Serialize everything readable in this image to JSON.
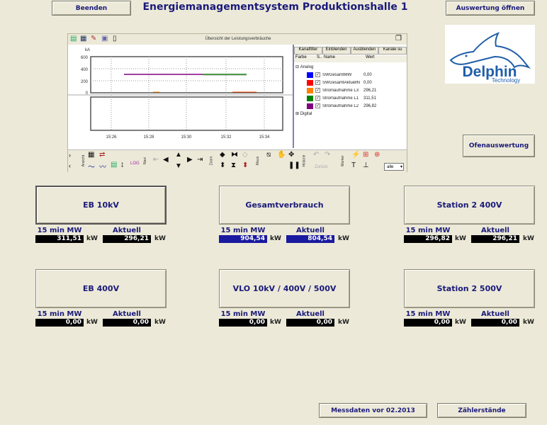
{
  "header": {
    "exit": "Beenden",
    "title": "Energiemanagementsystem Produktionshalle 1",
    "open_eval": "Auswertung öffnen"
  },
  "logo": {
    "brand": "Delphin",
    "sub": "Technology"
  },
  "chart": {
    "title": "Übersicht der Leistungsverbräuche",
    "unit": "kA",
    "yticks": [
      "600",
      "400",
      "200",
      "0"
    ],
    "xticks": [
      "15:26",
      "15:28",
      "15:30",
      "15:32",
      "15:34"
    ]
  },
  "legend": {
    "tabs": [
      "Kanalfilter",
      "Einblenden",
      "Ausblenden",
      "Kanäle su"
    ],
    "cols": [
      "Farbe",
      "S..",
      "Name",
      "Wert"
    ],
    "group_analog": "Analog",
    "group_digital": "Digital",
    "channels": [
      {
        "name": "SWGesamtMW",
        "value": "0,00",
        "color": "#0000ff"
      },
      {
        "name": "SWGesamtAktuellN",
        "value": "0,00",
        "color": "#ff0000"
      },
      {
        "name": "Stromaufnahme L3",
        "value": "296,21",
        "color": "#ff8000"
      },
      {
        "name": "Stromaufnahme L1",
        "value": "311,51",
        "color": "#008000"
      },
      {
        "name": "Stromaufnahme L2",
        "value": "296,82",
        "color": "#800080"
      }
    ]
  },
  "toolbar": {
    "groups": [
      "Ansicht",
      "Navi",
      "Zoom",
      "Maus",
      "Historie",
      "Marker"
    ],
    "back": "Zurück",
    "select": "alle"
  },
  "oven": "Ofenauswertung",
  "labels": {
    "avg": "15 min MW",
    "cur": "Aktuell",
    "unit": "kW"
  },
  "stations": [
    {
      "name": "EB 10kV",
      "avg": "311,51",
      "cur": "296,21"
    },
    {
      "name": "Gesamtverbrauch",
      "avg": "904,54",
      "cur": "804,54"
    },
    {
      "name": "Station 2 400V",
      "avg": "296,82",
      "cur": "296,21"
    },
    {
      "name": "EB 400V",
      "avg": "0,00",
      "cur": "0,00"
    },
    {
      "name": "VLO 10kV / 400V / 500V",
      "avg": "0,00",
      "cur": "0,00"
    },
    {
      "name": "Station 2 500V",
      "avg": "0,00",
      "cur": "0,00"
    }
  ],
  "footer": {
    "history": "Messdaten vor 02.2013",
    "meters": "Zählerstände"
  }
}
